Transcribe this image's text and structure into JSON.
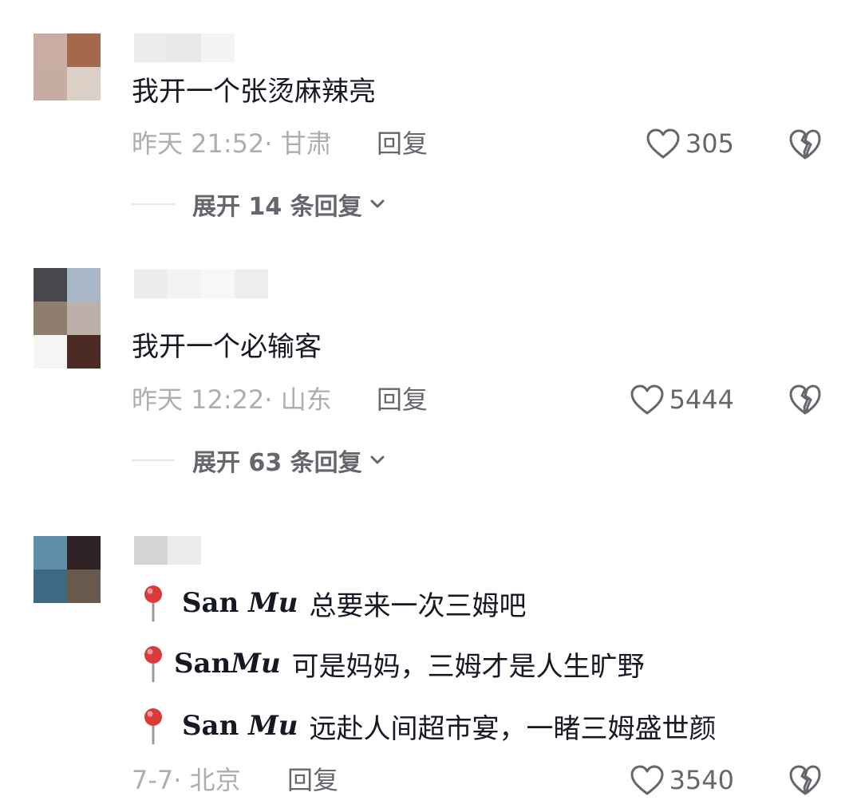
{
  "colors": {
    "text_primary": "#161823",
    "text_meta": "#aeaeb1",
    "text_action": "#66676d",
    "divider": "#e6e6e7",
    "pin_red": "#d93a3a"
  },
  "comments": [
    {
      "text": "我开一个张烫麻辣亮",
      "meta": "昨天 21:52· 甘肃",
      "reply_label": "回复",
      "likes": "305",
      "expand_label": "展开 14 条回复",
      "icons": {
        "like": "heart-outline-icon",
        "dislike": "broken-heart-icon",
        "expand": "chevron-down-icon"
      }
    },
    {
      "text": "我开一个必输客",
      "meta": "昨天 12:22· 山东",
      "reply_label": "回复",
      "likes": "5444",
      "expand_label": "展开 63 条回复",
      "icons": {
        "like": "heart-outline-icon",
        "dislike": "broken-heart-icon",
        "expand": "chevron-down-icon"
      }
    },
    {
      "lines": [
        {
          "brand_a": "San",
          "brand_b": "Mu",
          "text": "总要来一次三姆吧"
        },
        {
          "brand_a": "San",
          "brand_b": "Mu",
          "text": "可是妈妈，三姆才是人生旷野"
        },
        {
          "brand_a": "San",
          "brand_b": "Mu",
          "text": "远赴人间超市宴，一睹三姆盛世颜"
        }
      ],
      "meta": "7-7· 北京",
      "reply_label": "回复",
      "likes": "3540",
      "icons": {
        "line": "pushpin-icon",
        "like": "heart-outline-icon",
        "dislike": "broken-heart-icon"
      }
    }
  ]
}
